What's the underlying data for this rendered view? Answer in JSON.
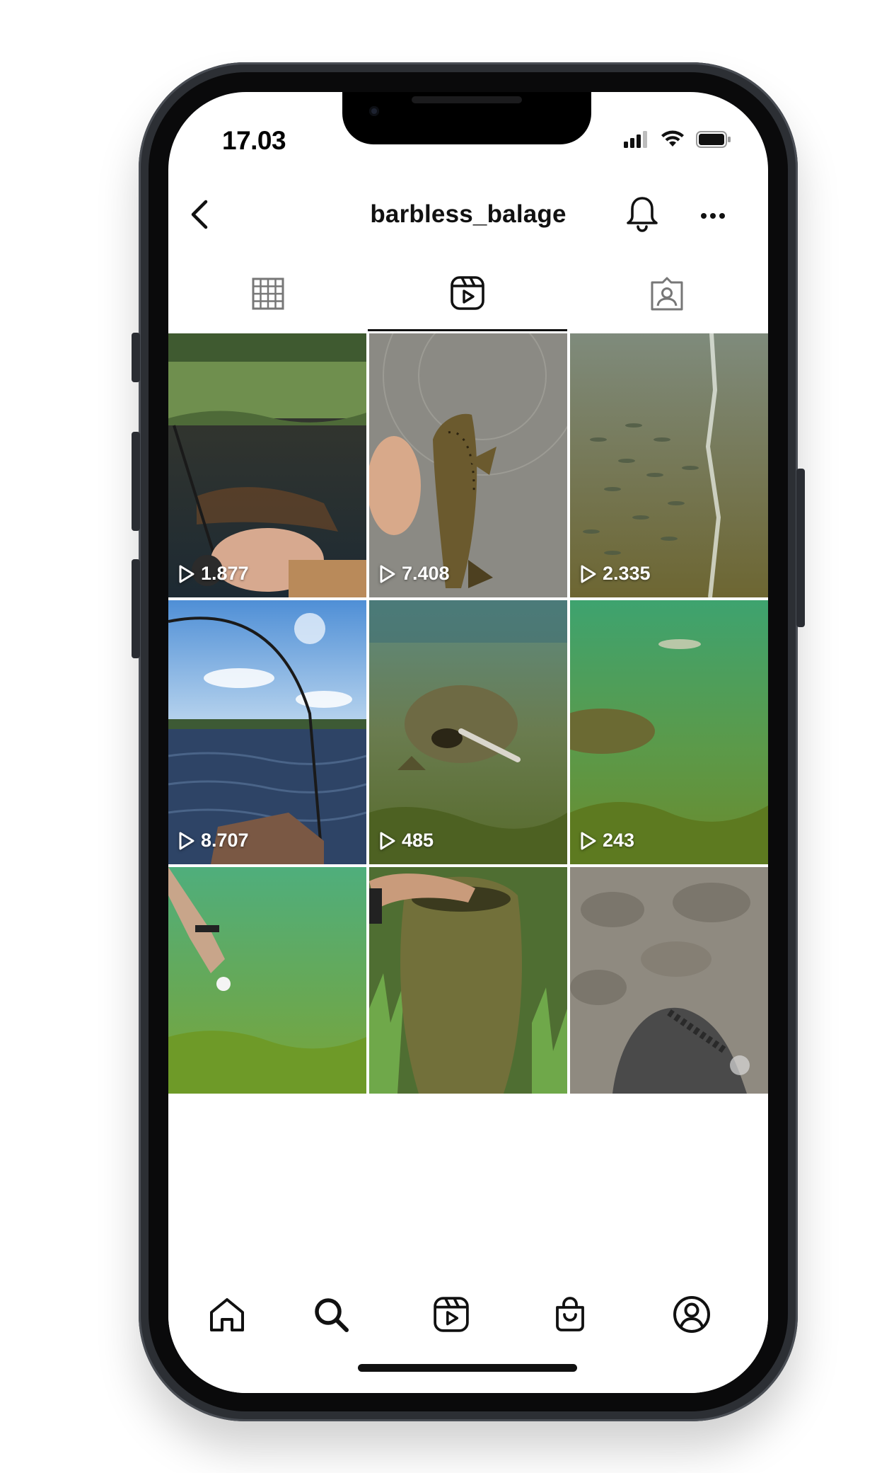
{
  "status_bar": {
    "time": "17.03",
    "icons": [
      "cellular-signal-icon",
      "wifi-icon",
      "battery-icon"
    ]
  },
  "header": {
    "username": "barbless_balage",
    "icons": [
      "back-arrow-icon",
      "bell-icon",
      "more-options-icon"
    ]
  },
  "profile_tabs": [
    {
      "name": "grid-icon",
      "selected": false
    },
    {
      "name": "reels-icon",
      "selected": true
    },
    {
      "name": "tagged-icon",
      "selected": false
    }
  ],
  "reels": [
    {
      "views": "1.877",
      "scene": "river bank, fishing rod and reel"
    },
    {
      "views": "7.408",
      "scene": "hand holding brown trout"
    },
    {
      "views": "2.335",
      "scene": "school of fish in shallow water"
    },
    {
      "views": "8.707",
      "scene": "bent rod over lake, blue sky"
    },
    {
      "views": "485",
      "scene": "underwater fish strikes lure"
    },
    {
      "views": "243",
      "scene": "underwater fish chasing lure"
    },
    {
      "views": "",
      "scene": "underwater hand with lure"
    },
    {
      "views": "",
      "scene": "hand holding catfish on grass"
    },
    {
      "views": "",
      "scene": "fish over rocky riverbed"
    }
  ],
  "bottom_nav": [
    "home-icon",
    "search-icon",
    "reels-icon",
    "shop-icon",
    "profile-icon"
  ],
  "colors": {
    "text": "#111111",
    "phone_frame": "#2c2f34",
    "background": "#ffffff"
  }
}
